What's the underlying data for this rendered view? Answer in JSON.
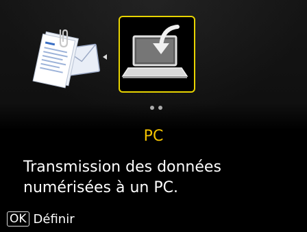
{
  "screen": {
    "menu": {
      "items": [
        {
          "icon": "document-mail-icon",
          "selected": false
        },
        {
          "icon": "laptop-save-icon",
          "selected": true
        }
      ],
      "page_indicator": {
        "count": 2
      }
    },
    "title": "PC",
    "description_line1": "Transmission des données",
    "description_line2": "numérisées à un PC.",
    "footer": {
      "key_label": "OK",
      "action_label": "Définir"
    }
  },
  "colors": {
    "selection_border": "#e8d400",
    "title": "#f5c400",
    "text": "#ffffff",
    "background": "#000000"
  }
}
